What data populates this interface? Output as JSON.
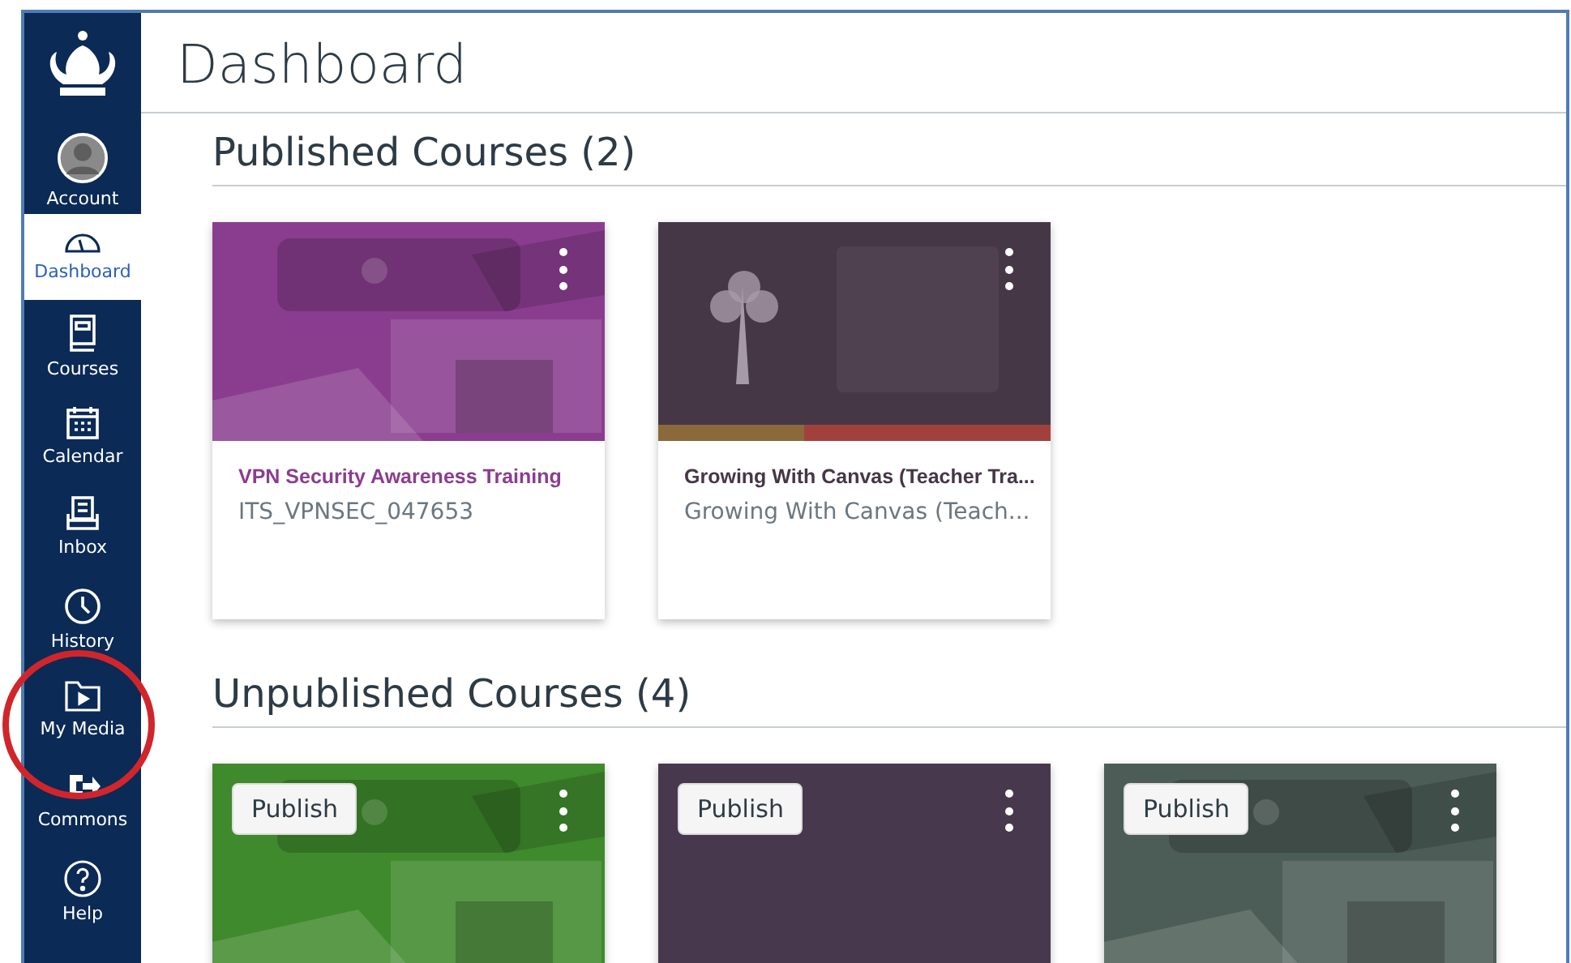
{
  "sidebar": {
    "items": [
      {
        "label": "Account",
        "selected": false
      },
      {
        "label": "Dashboard",
        "selected": true
      },
      {
        "label": "Courses",
        "selected": false
      },
      {
        "label": "Calendar",
        "selected": false
      },
      {
        "label": "Inbox",
        "selected": false
      },
      {
        "label": "History",
        "selected": false
      },
      {
        "label": "My Media",
        "selected": false
      },
      {
        "label": "Commons",
        "selected": false
      },
      {
        "label": "Help",
        "selected": false
      }
    ]
  },
  "header": {
    "title": "Dashboard"
  },
  "sections": [
    {
      "title": "Published Courses (2)",
      "cards": [
        {
          "color": "#8a3d8f",
          "title": "VPN Security Awareness Training",
          "code": "ITS_VPNSEC_047653"
        },
        {
          "kind": "graphic",
          "color": "#463747",
          "title": "Growing With Canvas (Teacher Tra...",
          "code": "Growing With Canvas (Teach..."
        }
      ]
    },
    {
      "title": "Unpublished Courses (4)",
      "cards": [
        {
          "color": "#3f8a2c",
          "button": "Publish"
        },
        {
          "kind": "plain",
          "color": "#48384d",
          "button": "Publish"
        },
        {
          "color": "#4c5c56",
          "button": "Publish"
        }
      ]
    }
  ],
  "annotation": {
    "kind": "circle"
  }
}
